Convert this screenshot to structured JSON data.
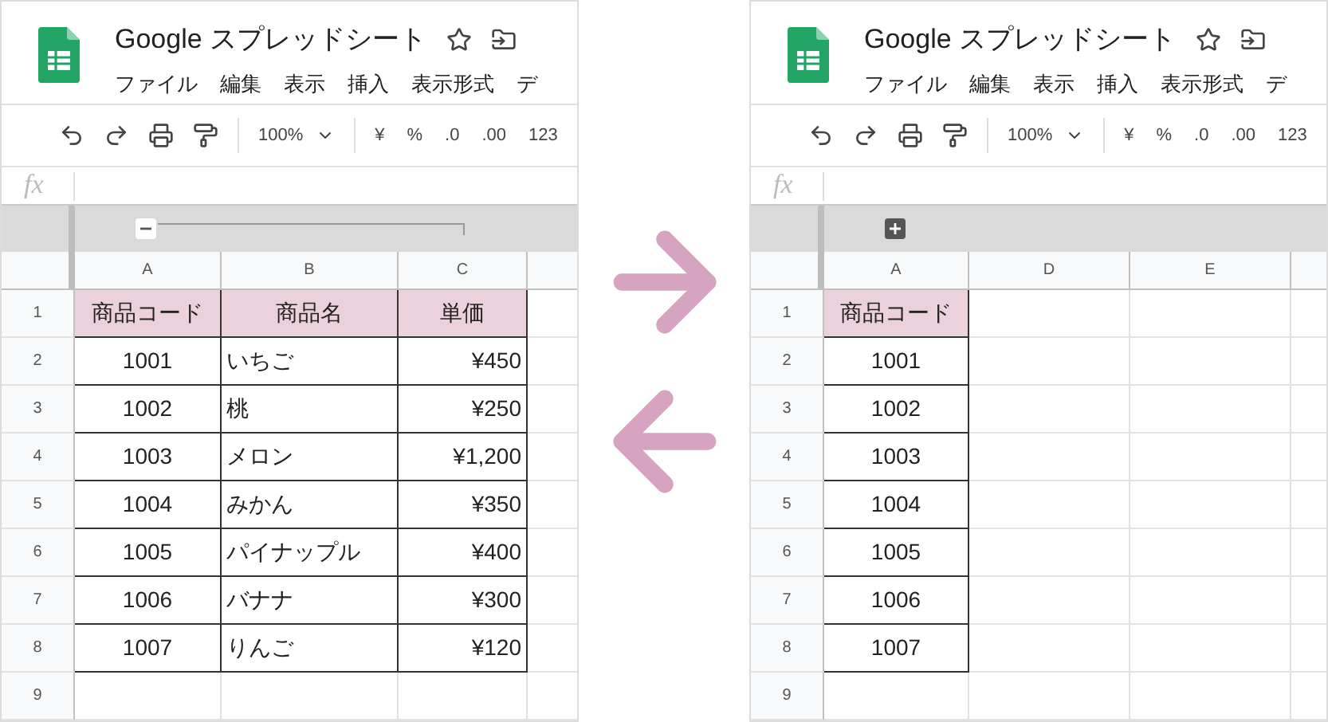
{
  "panels": [
    {
      "title": "Google スプレッドシート",
      "menu": [
        "ファイル",
        "編集",
        "表示",
        "挿入",
        "表示形式",
        "デ"
      ],
      "toolbar": {
        "zoom": "100%",
        "formats": [
          "¥",
          "%",
          ".0",
          ".00",
          "123"
        ]
      },
      "formula_label": "fx",
      "group": {
        "expanded": true
      },
      "columns": [
        {
          "label": "A",
          "kind": "code"
        },
        {
          "label": "B",
          "kind": "name"
        },
        {
          "label": "C",
          "kind": "price"
        }
      ],
      "rows": [
        {
          "number": "1",
          "header": true,
          "cells": [
            "商品コード",
            "商品名",
            "単価"
          ]
        },
        {
          "number": "2",
          "header": false,
          "cells": [
            "1001",
            "いちご",
            "¥450"
          ]
        },
        {
          "number": "3",
          "header": false,
          "cells": [
            "1002",
            "桃",
            "¥250"
          ]
        },
        {
          "number": "4",
          "header": false,
          "cells": [
            "1003",
            "メロン",
            "¥1,200"
          ]
        },
        {
          "number": "5",
          "header": false,
          "cells": [
            "1004",
            "みかん",
            "¥350"
          ]
        },
        {
          "number": "6",
          "header": false,
          "cells": [
            "1005",
            "パイナップル",
            "¥400"
          ]
        },
        {
          "number": "7",
          "header": false,
          "cells": [
            "1006",
            "バナナ",
            "¥300"
          ]
        },
        {
          "number": "8",
          "header": false,
          "cells": [
            "1007",
            "りんご",
            "¥120"
          ]
        },
        {
          "number": "9",
          "header": false,
          "cells": []
        }
      ]
    },
    {
      "title": "Google スプレッドシート",
      "menu": [
        "ファイル",
        "編集",
        "表示",
        "挿入",
        "表示形式",
        "デ"
      ],
      "toolbar": {
        "zoom": "100%",
        "formats": [
          "¥",
          "%",
          ".0",
          ".00",
          "123"
        ]
      },
      "formula_label": "fx",
      "group": {
        "expanded": false
      },
      "columns": [
        {
          "label": "A",
          "kind": "code"
        },
        {
          "label": "D"
        },
        {
          "label": "E"
        }
      ],
      "rows": [
        {
          "number": "1",
          "header": true,
          "cells": [
            "商品コード"
          ]
        },
        {
          "number": "2",
          "header": false,
          "cells": [
            "1001"
          ]
        },
        {
          "number": "3",
          "header": false,
          "cells": [
            "1002"
          ]
        },
        {
          "number": "4",
          "header": false,
          "cells": [
            "1003"
          ]
        },
        {
          "number": "5",
          "header": false,
          "cells": [
            "1004"
          ]
        },
        {
          "number": "6",
          "header": false,
          "cells": [
            "1005"
          ]
        },
        {
          "number": "7",
          "header": false,
          "cells": [
            "1006"
          ]
        },
        {
          "number": "8",
          "header": false,
          "cells": [
            "1007"
          ]
        },
        {
          "number": "9",
          "header": false,
          "cells": []
        }
      ]
    }
  ]
}
